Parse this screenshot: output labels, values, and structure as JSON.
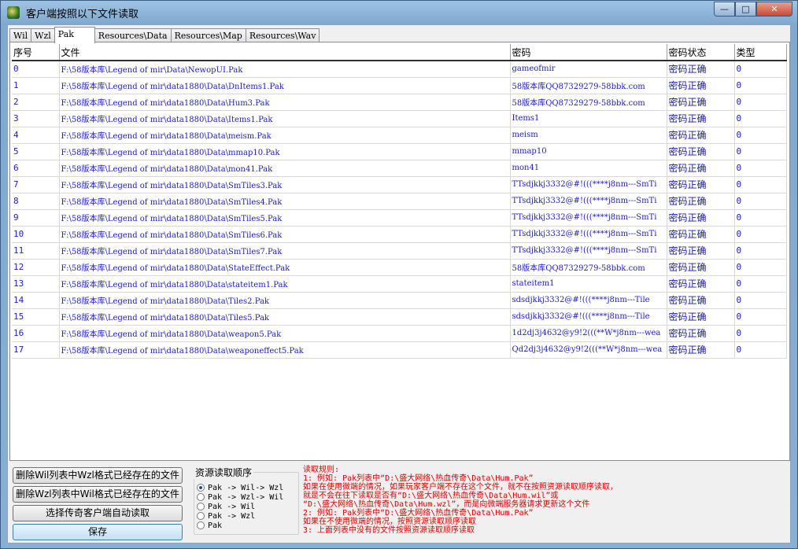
{
  "window": {
    "title": "客户端按照以下文件读取",
    "min_glyph": "—",
    "max_glyph": "□",
    "close_glyph": "✕"
  },
  "tabs": [
    "Wil",
    "Wzl",
    "Pak",
    "Resources\\Data",
    "Resources\\Map",
    "Resources\\Wav"
  ],
  "active_tab": "Pak",
  "table": {
    "columns": [
      "序号",
      "文件",
      "密码",
      "密码状态",
      "类型"
    ],
    "rows": [
      [
        "0",
        "F:\\58版本库\\Legend of mir\\Data\\NewopUI.Pak",
        "gameofmir",
        "密码正确",
        "0"
      ],
      [
        "1",
        "F:\\58版本库\\Legend of mir\\data1880\\Data\\DnItems1.Pak",
        "58版本库QQ87329279-58bbk.com",
        "密码正确",
        "0"
      ],
      [
        "2",
        "F:\\58版本库\\Legend of mir\\data1880\\Data\\Hum3.Pak",
        "58版本库QQ87329279-58bbk.com",
        "密码正确",
        "0"
      ],
      [
        "3",
        "F:\\58版本库\\Legend of mir\\data1880\\Data\\Items1.Pak",
        "Items1",
        "密码正确",
        "0"
      ],
      [
        "4",
        "F:\\58版本库\\Legend of mir\\data1880\\Data\\meism.Pak",
        "meism",
        "密码正确",
        "0"
      ],
      [
        "5",
        "F:\\58版本库\\Legend of mir\\data1880\\Data\\mmap10.Pak",
        "mmap10",
        "密码正确",
        "0"
      ],
      [
        "6",
        "F:\\58版本库\\Legend of mir\\data1880\\Data\\mon41.Pak",
        "mon41",
        "密码正确",
        "0"
      ],
      [
        "7",
        "F:\\58版本库\\Legend of mir\\data1880\\Data\\SmTiles3.Pak",
        "TTsdjkkj3332@#!(((****j8nm---SmTi",
        "密码正确",
        "0"
      ],
      [
        "8",
        "F:\\58版本库\\Legend of mir\\data1880\\Data\\SmTiles4.Pak",
        "TTsdjkkj3332@#!(((****j8nm---SmTi",
        "密码正确",
        "0"
      ],
      [
        "9",
        "F:\\58版本库\\Legend of mir\\data1880\\Data\\SmTiles5.Pak",
        "TTsdjkkj3332@#!(((****j8nm---SmTi",
        "密码正确",
        "0"
      ],
      [
        "10",
        "F:\\58版本库\\Legend of mir\\data1880\\Data\\SmTiles6.Pak",
        "TTsdjkkj3332@#!(((****j8nm---SmTi",
        "密码正确",
        "0"
      ],
      [
        "11",
        "F:\\58版本库\\Legend of mir\\data1880\\Data\\SmTiles7.Pak",
        "TTsdjkkj3332@#!(((****j8nm---SmTi",
        "密码正确",
        "0"
      ],
      [
        "12",
        "F:\\58版本库\\Legend of mir\\data1880\\Data\\StateEffect.Pak",
        "58版本库QQ87329279-58bbk.com",
        "密码正确",
        "0"
      ],
      [
        "13",
        "F:\\58版本库\\Legend of mir\\data1880\\Data\\stateitem1.Pak",
        "stateitem1",
        "密码正确",
        "0"
      ],
      [
        "14",
        "F:\\58版本库\\Legend of mir\\data1880\\Data\\Tiles2.Pak",
        "sdsdjkkj3332@#!(((****j8nm---Tile",
        "密码正确",
        "0"
      ],
      [
        "15",
        "F:\\58版本库\\Legend of mir\\data1880\\Data\\Tiles5.Pak",
        "sdsdjkkj3332@#!(((****j8nm---Tile",
        "密码正确",
        "0"
      ],
      [
        "16",
        "F:\\58版本库\\Legend of mir\\data1880\\Data\\weapon5.Pak",
        "1d2dj3j4632@y9!2(((**W*j8nm---wea",
        "密码正确",
        "0"
      ],
      [
        "17",
        "F:\\58版本库\\Legend of mir\\data1880\\Data\\weaponeffect5.Pak",
        "Qd2dj3j4632@y9!2(((**W*j8nm---wea",
        "密码正确",
        "0"
      ]
    ]
  },
  "buttons": {
    "delete_wil": "删除Wil列表中Wzl格式已经存在的文件",
    "delete_wzl": "删除Wzl列表中Wil格式已经存在的文件",
    "select_client": "选择传奇客户端自动读取",
    "save": "保存"
  },
  "order": {
    "title": "资源读取顺序",
    "options": [
      "Pak -> Wil-> Wzl",
      "Pak -> Wzl-> Wil",
      "Pak -> Wil",
      "Pak -> Wzl",
      "Pak"
    ],
    "selected_index": 0
  },
  "rules": [
    "读取规则:",
    "1: 例如: Pak列表中“D:\\盛大网络\\热血传奇\\Data\\Hum.Pak”",
    "    如果在使用微端的情况，如果玩家客户端不存在这个文件，就不在按照资源读取顺序读取，",
    "    就是不会在往下读取是否有“D:\\盛大网络\\热血传奇\\Data\\Hum.wil”或",
    "  “D:\\盛大网络\\热血传奇\\Data\\Hum.wzl”，而是向微端服务器请求更新这个文件",
    "2: 例如: Pak列表中“D:\\盛大网络\\热血传奇\\Data\\Hum.Pak”",
    "    如果在不使用微端的情况，按照资源读取顺序读取",
    "3: 上面列表中没有的文件按照资源读取顺序读取"
  ]
}
